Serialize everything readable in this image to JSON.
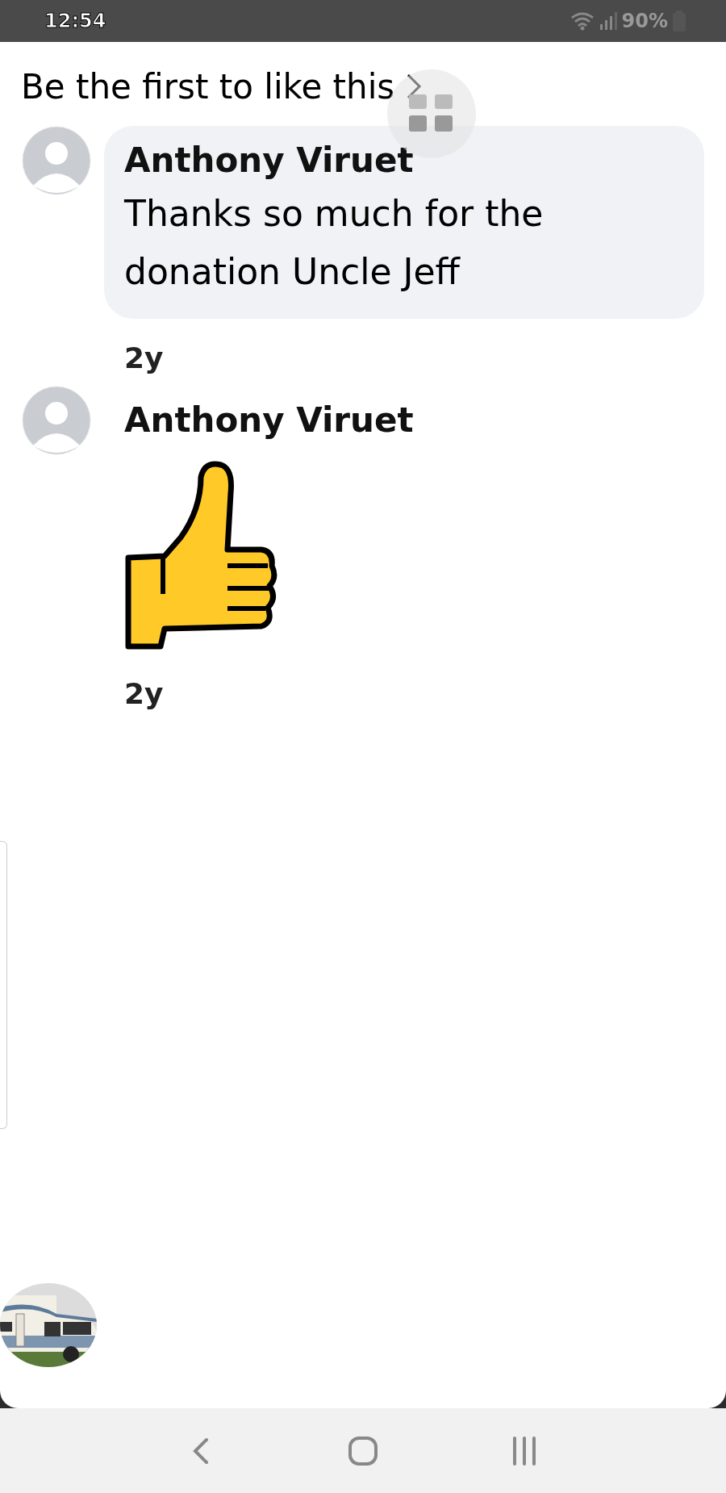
{
  "status_bar": {
    "time": "12:54",
    "battery": "90%"
  },
  "likes_prompt": "Be the first to like this",
  "comments": [
    {
      "kind": "text",
      "author": "Anthony Viruet",
      "text": "Thanks so much for the donation Uncle Jeff",
      "age": "2y"
    },
    {
      "kind": "sticker",
      "author": "Anthony Viruet",
      "age": "2y"
    }
  ]
}
